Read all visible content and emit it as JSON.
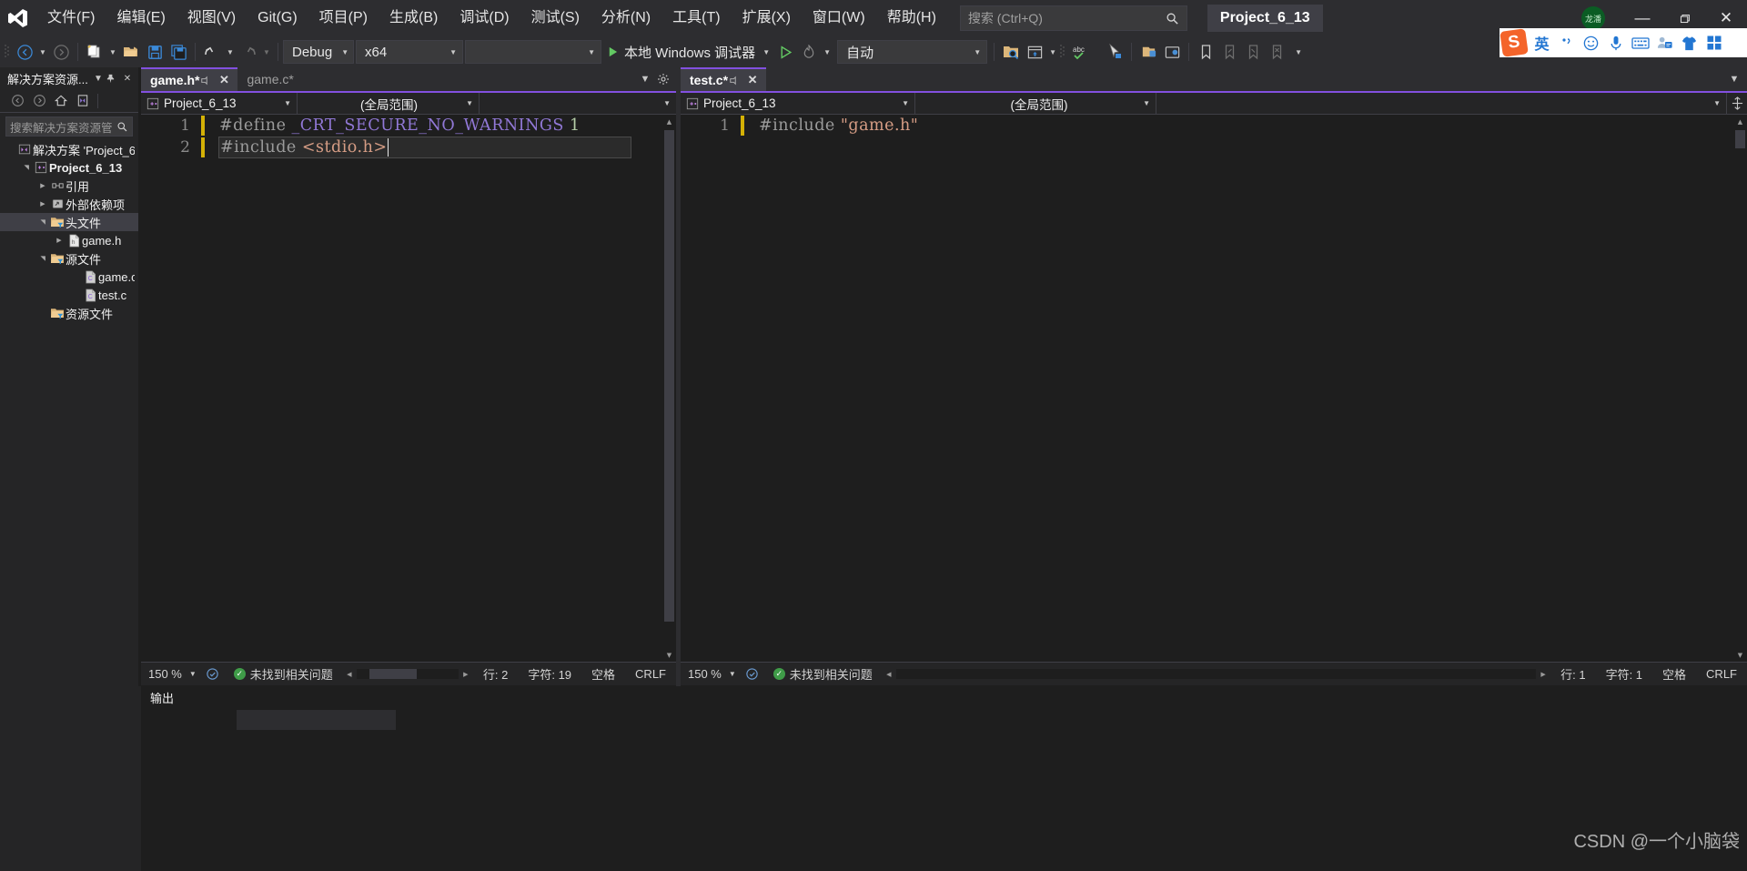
{
  "app": {
    "title": "Project_6_13",
    "user_badge": "龙潘"
  },
  "menu": {
    "items": [
      {
        "label": "文件(F)"
      },
      {
        "label": "编辑(E)"
      },
      {
        "label": "视图(V)"
      },
      {
        "label": "Git(G)"
      },
      {
        "label": "项目(P)"
      },
      {
        "label": "生成(B)"
      },
      {
        "label": "调试(D)"
      },
      {
        "label": "测试(S)"
      },
      {
        "label": "分析(N)"
      },
      {
        "label": "工具(T)"
      },
      {
        "label": "扩展(X)"
      },
      {
        "label": "窗口(W)"
      },
      {
        "label": "帮助(H)"
      }
    ]
  },
  "search": {
    "placeholder": "搜索 (Ctrl+Q)",
    "icon": "search-icon"
  },
  "window_controls": {
    "minimize": "—",
    "maximize": "❐",
    "close": "✕"
  },
  "toolbar": {
    "back_icon": "back-arrow-icon",
    "forward_icon": "forward-arrow-icon",
    "new_project_icon": "new-project-icon",
    "open_file_icon": "open-folder-icon",
    "save_icon": "save-icon",
    "save_all_icon": "save-all-icon",
    "undo_icon": "undo-icon",
    "redo_icon": "redo-icon",
    "configuration": "Debug",
    "platform": "x64",
    "target_empty": "",
    "run_label": "本地 Windows 调试器",
    "attach_icon": "attach-process-icon",
    "hot_reload_icon": "hot-reload-icon",
    "auto_label": "自动",
    "find_in_files_icon": "find-in-files-icon",
    "window_layout_icon": "window-layout-icon",
    "spellcheck_icon": "abc-spellcheck-icon",
    "pointer_icon": "live-share-pointer-icon",
    "bookmark_icon": "bookmark-icon",
    "prev_bookmark_icon": "previous-bookmark-icon",
    "next_bookmark_icon": "next-bookmark-icon",
    "clear_bookmark_icon": "clear-bookmarks-icon",
    "overflow_icon": "toolbar-overflow-icon"
  },
  "solution_explorer": {
    "title": "解决方案资源...",
    "dropdown_icon": "chevron-down-icon",
    "pin_icon": "pin-icon",
    "close_icon": "close-icon",
    "tools": [
      "back-arrow-icon",
      "forward-arrow-icon",
      "home-icon",
      "sync-views-icon"
    ],
    "search_placeholder": "搜索解决方案资源管",
    "search_icon": "search-icon",
    "tree": [
      {
        "label": "解决方案 'Project_6",
        "icon": "solution-icon",
        "indent": 0,
        "expander": "",
        "bold": false,
        "selected": false
      },
      {
        "label": "Project_6_13",
        "icon": "cpp-project-icon",
        "indent": 1,
        "expander": "▲",
        "bold": true,
        "selected": false
      },
      {
        "label": "引用",
        "icon": "references-icon",
        "indent": 2,
        "expander": "▶",
        "bold": false,
        "selected": false
      },
      {
        "label": "外部依赖项",
        "icon": "external-deps-icon",
        "indent": 2,
        "expander": "▶",
        "bold": false,
        "selected": false
      },
      {
        "label": "头文件",
        "icon": "filter-folder-icon",
        "indent": 2,
        "expander": "▲",
        "bold": false,
        "selected": true
      },
      {
        "label": "game.h",
        "icon": "header-file-icon",
        "indent": 3,
        "expander": "▶",
        "bold": false,
        "selected": false
      },
      {
        "label": "源文件",
        "icon": "filter-folder-icon",
        "indent": 2,
        "expander": "▲",
        "bold": false,
        "selected": false
      },
      {
        "label": "game.c",
        "icon": "c-file-icon",
        "indent": 4,
        "expander": "",
        "bold": false,
        "selected": false
      },
      {
        "label": "test.c",
        "icon": "c-file-icon",
        "indent": 4,
        "expander": "",
        "bold": false,
        "selected": false
      },
      {
        "label": "资源文件",
        "icon": "filter-folder-icon",
        "indent": 2,
        "expander": "",
        "bold": false,
        "selected": false
      }
    ]
  },
  "left_pane": {
    "tabs": [
      {
        "label": "game.h*",
        "active": true,
        "pin_icon": "pin-icon",
        "close_icon": "close-icon"
      },
      {
        "label": "game.c*",
        "active": false
      }
    ],
    "tabstrip_dropdown_icon": "chevron-down-icon",
    "tabstrip_settings_icon": "gear-icon",
    "nav_project": "Project_6_13",
    "nav_scope": "(全局范围)",
    "nav_member": "",
    "code_lines": [
      {
        "num": "1",
        "changed": true,
        "tokens": [
          {
            "t": "#define ",
            "c": "pp"
          },
          {
            "t": "_CRT_SECURE_NO_WARNINGS ",
            "c": "macro"
          },
          {
            "t": "1",
            "c": "num"
          }
        ]
      },
      {
        "num": "2",
        "changed": true,
        "selected": true,
        "caret": true,
        "tokens": [
          {
            "t": "#include ",
            "c": "pp"
          },
          {
            "t": "<stdio.h>",
            "c": "str"
          }
        ]
      }
    ],
    "status": {
      "zoom": "150 %",
      "zoom_caret": "▾",
      "intellisense_icon": "intellisense-icon",
      "errors": "未找到相关问题",
      "line": "行: 2",
      "column": "字符: 19",
      "spaces": "空格",
      "eol": "CRLF"
    }
  },
  "right_pane": {
    "tabs": [
      {
        "label": "test.c*",
        "active": true,
        "pin_icon": "pin-icon",
        "close_icon": "close-icon"
      }
    ],
    "split_icon": "split-view-icon",
    "nav_project": "Project_6_13",
    "nav_scope": "(全局范围)",
    "nav_member": "",
    "code_lines": [
      {
        "num": "1",
        "changed": true,
        "tokens": [
          {
            "t": "#include ",
            "c": "pp"
          },
          {
            "t": "\"game.h\"",
            "c": "str"
          }
        ]
      }
    ],
    "status": {
      "zoom": "150 %",
      "zoom_caret": "▾",
      "intellisense_icon": "intellisense-icon",
      "errors": "未找到相关问题",
      "line": "行: 1",
      "column": "字符: 1",
      "spaces": "空格",
      "eol": "CRLF"
    }
  },
  "output_panel": {
    "title": "输出",
    "tab": ""
  },
  "ime": {
    "logo": "S",
    "mode": "英",
    "buttons": [
      "comma-icon",
      "smiley-icon",
      "microphone-icon",
      "keyboard-icon",
      "card-icon",
      "skin-icon",
      "toolbox-icon"
    ]
  },
  "watermark": "CSDN @一个小脑袋",
  "colors": {
    "accent": "#8250df",
    "chrome": "#2d2d30",
    "editor_bg": "#1e1e1e",
    "panel_bg": "#252526",
    "change_bar": "#d4b106",
    "string": "#d69d85",
    "macro": "#9178d6",
    "ok_green": "#3f9c48"
  }
}
